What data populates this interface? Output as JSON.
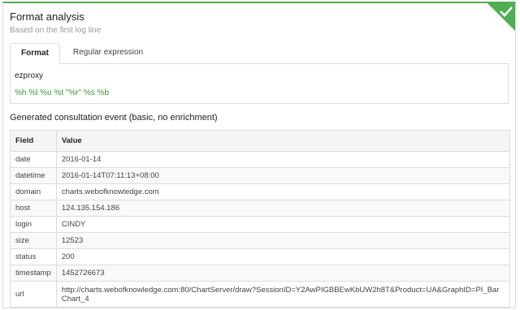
{
  "header": {
    "title": "Format analysis",
    "subtitle": "Based on the first log line",
    "status_icon": "check-icon",
    "accent_color": "#4caf50"
  },
  "tabs": [
    {
      "label": "Format",
      "active": true
    },
    {
      "label": "Regular expression",
      "active": false
    }
  ],
  "format": {
    "name": "ezproxy",
    "pattern": "%h %l %u %t \"%r\" %s %b"
  },
  "section": {
    "title": "Generated consultation event (basic, no enrichment)"
  },
  "table": {
    "headers": [
      "Field",
      "Value"
    ],
    "rows": [
      {
        "field": "date",
        "value": "2016-01-14"
      },
      {
        "field": "datetime",
        "value": "2016-01-14T07:11:13+08:00"
      },
      {
        "field": "domain",
        "value": "charts.webofknowledge.com"
      },
      {
        "field": "host",
        "value": "124.135.154.186"
      },
      {
        "field": "login",
        "value": "CINDY"
      },
      {
        "field": "size",
        "value": "12523"
      },
      {
        "field": "status",
        "value": "200"
      },
      {
        "field": "timestamp",
        "value": "1452726673"
      },
      {
        "field": "url",
        "value": "http://charts.webofknowledge.com:80/ChartServer/draw?SessionID=Y2AwPIGBBEwKbUW2h8T&Product=UA&GraphID=PI_BarChart_4"
      }
    ]
  }
}
